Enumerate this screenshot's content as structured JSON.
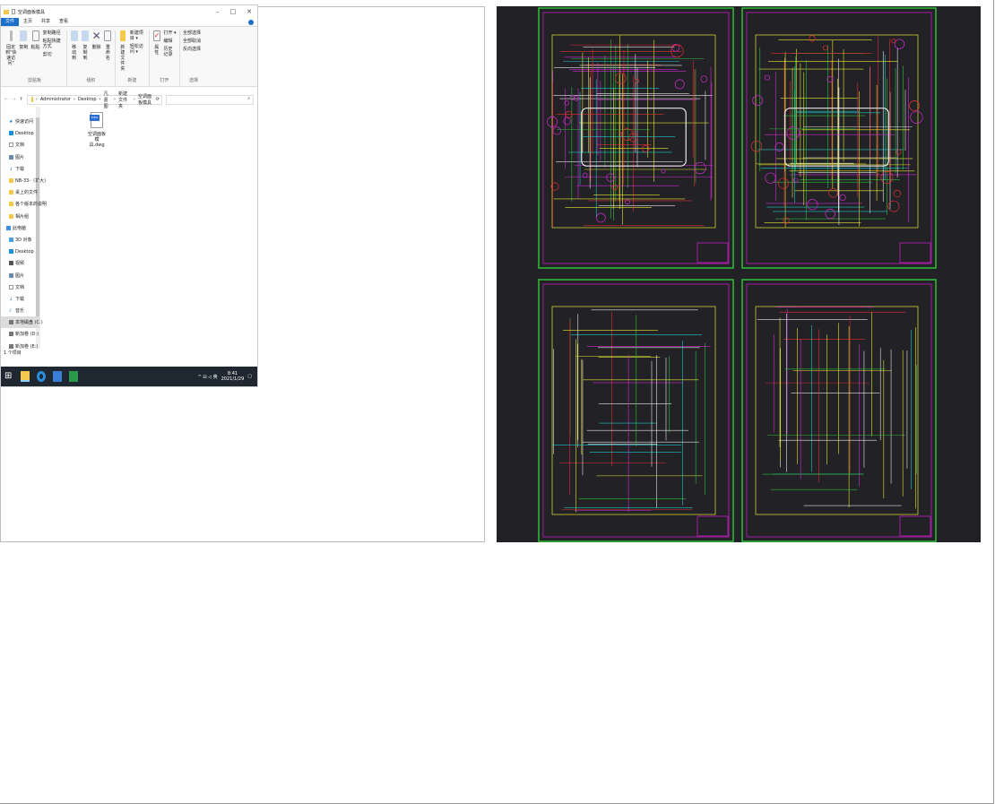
{
  "explorer": {
    "title": "空调面板模具",
    "window_controls": [
      "–",
      "□",
      "✕"
    ],
    "tabs": [
      "文件",
      "主页",
      "共享",
      "查看"
    ],
    "ribbon": {
      "clipboard": {
        "label": "剪贴板",
        "pin": "固定到\"快速访问\"",
        "copy": "复制",
        "paste": "粘贴",
        "copy_path": "复制路径",
        "paste_shortcut": "粘贴快捷方式",
        "cut": "剪切"
      },
      "organize": {
        "label": "组织",
        "move_to": "移动到",
        "copy_to": "复制到",
        "delete": "删除",
        "rename": "重命名"
      },
      "new": {
        "label": "新建",
        "new_folder": "新建文件夹",
        "new_item": "新建项目 ▾",
        "easy_access": "轻松访问 ▾"
      },
      "open": {
        "label": "打开",
        "properties": "属性",
        "open": "打开 ▾",
        "edit": "编辑",
        "history": "历史记录"
      },
      "select": {
        "label": "选择",
        "select_all": "全部选择",
        "select_none": "全部取消",
        "invert": "反向选择"
      }
    },
    "address": {
      "path": [
        "Administrator",
        "Desktop",
        "凡嘉图",
        "新建文件夹",
        "空调面板模具"
      ],
      "search_icon": "search-icon"
    },
    "nav": {
      "quick_access": "快速访问",
      "quick_items": [
        "Desktop",
        "文档",
        "图片",
        "下载",
        "NB-33-（扩大)",
        "桌上的文件",
        "各个版本的说明",
        "相片组"
      ],
      "this_pc": "此电脑",
      "pc_items": [
        "3D 对象",
        "Desktop",
        "视频",
        "图片",
        "文档",
        "下载",
        "音乐",
        "本地磁盘 (C:)",
        "新加卷 (D:)",
        "新加卷 (E:)"
      ]
    },
    "files": [
      {
        "name": "空调面板模具.dwg",
        "badge": "DWG"
      }
    ],
    "status": "1 个项目",
    "taskbar": {
      "time": "8:41",
      "date": "2021/1/29",
      "tray": "^ ⊟ ◁ 英"
    }
  },
  "cad": {
    "colors": {
      "background": "#212126",
      "sheet_border": "#2fbf3a",
      "inner_border": "#c21fc2",
      "lines": [
        "#e6e632",
        "#e8e8e8",
        "#d02ad0",
        "#2fbf3a",
        "#1fc7c7",
        "#e03030"
      ]
    }
  }
}
